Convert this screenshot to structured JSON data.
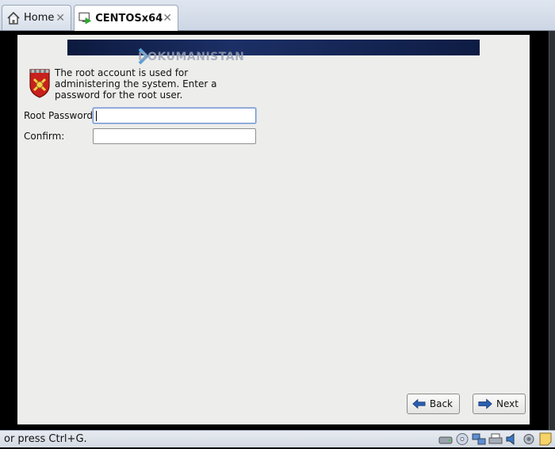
{
  "tabs": [
    {
      "label": "Home",
      "icon": "home-icon"
    },
    {
      "label": "CENTOSx64",
      "icon": "vm-running-icon",
      "active": true
    }
  ],
  "watermark": {
    "text": "DOKUMANISTAN"
  },
  "installer": {
    "info_text": "The root account is used for administering the system.  Enter a password for the root user.",
    "fields": {
      "root_password": {
        "label": "Root Password:",
        "value": ""
      },
      "confirm": {
        "label": "Confirm:",
        "value": ""
      }
    },
    "buttons": {
      "back": "Back",
      "next": "Next"
    }
  },
  "statusbar": {
    "text": "or press Ctrl+G.",
    "tray_icons": [
      "hard-disk-icon",
      "cd-icon",
      "network-icon",
      "printer-icon",
      "sound-icon",
      "usb-icon",
      "notes-icon"
    ]
  },
  "colors": {
    "banner": "#1c2f66",
    "installer_bg": "#ededeb",
    "accent": "#2a5fb0"
  }
}
